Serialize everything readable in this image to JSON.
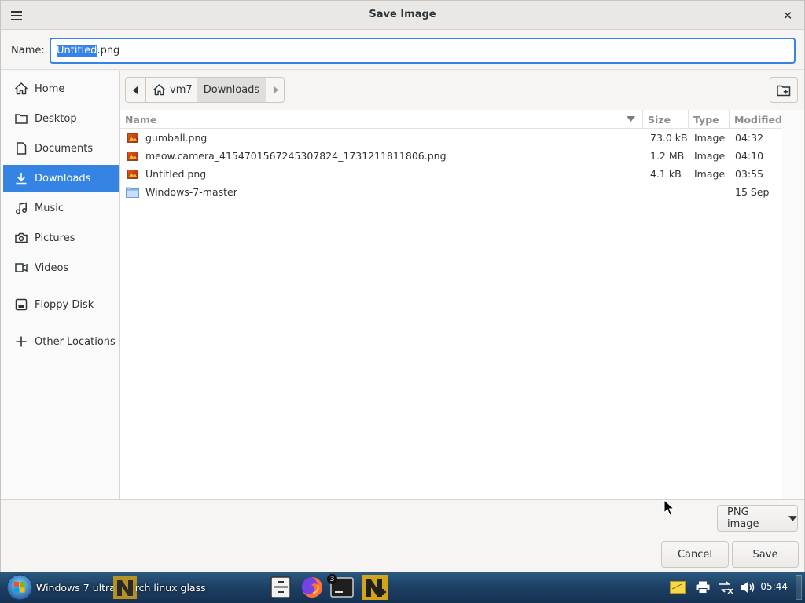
{
  "dialog": {
    "title": "Save Image",
    "name_label": "Name:",
    "filename_selected": "Untitled",
    "filename_rest": ".png"
  },
  "sidebar": {
    "items": [
      {
        "label": "Home",
        "icon": "home-icon"
      },
      {
        "label": "Desktop",
        "icon": "folder-icon"
      },
      {
        "label": "Documents",
        "icon": "document-icon"
      },
      {
        "label": "Downloads",
        "icon": "download-icon",
        "active": true
      },
      {
        "label": "Music",
        "icon": "music-icon"
      },
      {
        "label": "Pictures",
        "icon": "camera-icon"
      },
      {
        "label": "Videos",
        "icon": "video-icon"
      },
      {
        "label": "Floppy Disk",
        "icon": "drive-icon"
      },
      {
        "label": "Other Locations",
        "icon": "plus-icon"
      }
    ]
  },
  "pathbar": {
    "segments": [
      "vm7",
      "Downloads"
    ]
  },
  "columns": {
    "name": "Name",
    "size": "Size",
    "type": "Type",
    "modified": "Modified"
  },
  "files": [
    {
      "name": "gumball.png",
      "size": "73.0 kB",
      "type": "Image",
      "modified": "04:32",
      "kind": "image"
    },
    {
      "name": "meow.camera_4154701567245307824_1731211811806.png",
      "size": "1.2 MB",
      "type": "Image",
      "modified": "04:10",
      "kind": "image"
    },
    {
      "name": "Untitled.png",
      "size": "4.1 kB",
      "type": "Image",
      "modified": "03:55",
      "kind": "image"
    },
    {
      "name": "Windows-7-master",
      "size": "",
      "type": "",
      "modified": "15 Sep",
      "kind": "folder"
    }
  ],
  "footer": {
    "filter": "PNG image",
    "cancel": "Cancel",
    "save": "Save"
  },
  "taskbar": {
    "window_title": "Windows 7 ultra L",
    "window_title_rest": "rch linux glass",
    "terminal_badge": "3",
    "time": "05:44"
  },
  "colors": {
    "accent": "#3584e4",
    "taskbar": "#1d3f63"
  }
}
